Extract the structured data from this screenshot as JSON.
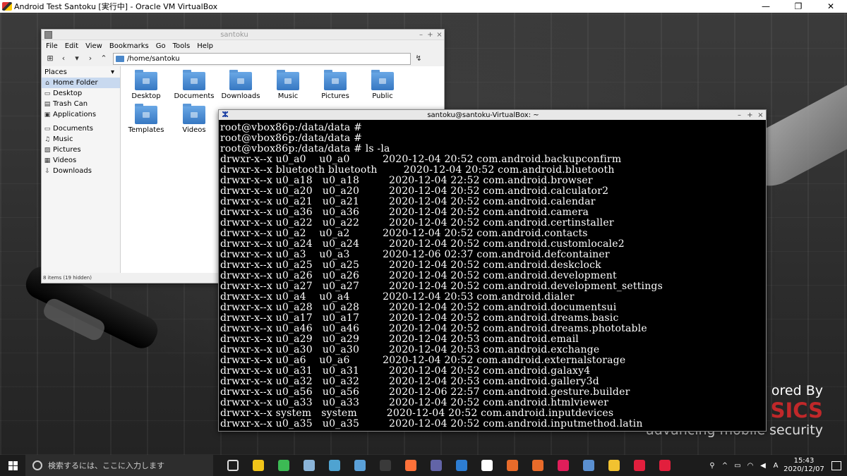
{
  "host": {
    "title": "Android Test Santoku [実行中] - Oracle VM VirtualBox",
    "minimize": "—",
    "maximize": "❐",
    "close": "✕"
  },
  "branding": {
    "powered": "ored By",
    "forensics": "SICS",
    "tagline": "advancing mobile security"
  },
  "file_manager": {
    "title": "santoku",
    "menu": [
      "File",
      "Edit",
      "View",
      "Bookmarks",
      "Go",
      "Tools",
      "Help"
    ],
    "path": "/home/santoku",
    "places_label": "Places",
    "places": [
      {
        "label": "Home Folder",
        "icon": "home-icon"
      },
      {
        "label": "Desktop",
        "icon": "desktop-icon"
      },
      {
        "label": "Trash Can",
        "icon": "trash-icon"
      },
      {
        "label": "Applications",
        "icon": "applications-icon"
      }
    ],
    "bookmarks": [
      {
        "label": "Documents",
        "icon": "folder-icon"
      },
      {
        "label": "Music",
        "icon": "music-icon"
      },
      {
        "label": "Pictures",
        "icon": "pictures-icon"
      },
      {
        "label": "Videos",
        "icon": "videos-icon"
      },
      {
        "label": "Downloads",
        "icon": "downloads-icon"
      }
    ],
    "folders": [
      "Desktop",
      "Documents",
      "Downloads",
      "Music",
      "Pictures",
      "Public",
      "Templates",
      "Videos"
    ],
    "status": "8 items (19 hidden)"
  },
  "terminal": {
    "title": "santoku@santoku-VirtualBox: ~",
    "lines": [
      "root@vbox86p:/data/data #",
      "root@vbox86p:/data/data #",
      "root@vbox86p:/data/data # ls -la",
      "drwxr-x--x u0_a0    u0_a0          2020-12-04 20:52 com.android.backupconfirm",
      "drwxr-x--x bluetooth bluetooth        2020-12-04 20:52 com.android.bluetooth",
      "drwxr-x--x u0_a18   u0_a18         2020-12-04 22:52 com.android.browser",
      "drwxr-x--x u0_a20   u0_a20         2020-12-04 20:52 com.android.calculator2",
      "drwxr-x--x u0_a21   u0_a21         2020-12-04 20:52 com.android.calendar",
      "drwxr-x--x u0_a36   u0_a36         2020-12-04 20:52 com.android.camera",
      "drwxr-x--x u0_a22   u0_a22         2020-12-04 20:52 com.android.certinstaller",
      "drwxr-x--x u0_a2    u0_a2          2020-12-04 20:52 com.android.contacts",
      "drwxr-x--x u0_a24   u0_a24         2020-12-04 20:52 com.android.customlocale2",
      "drwxr-x--x u0_a3    u0_a3          2020-12-06 02:37 com.android.defcontainer",
      "drwxr-x--x u0_a25   u0_a25         2020-12-04 20:52 com.android.deskclock",
      "drwxr-x--x u0_a26   u0_a26         2020-12-04 20:52 com.android.development",
      "drwxr-x--x u0_a27   u0_a27         2020-12-04 20:52 com.android.development_settings",
      "drwxr-x--x u0_a4    u0_a4          2020-12-04 20:53 com.android.dialer",
      "drwxr-x--x u0_a28   u0_a28         2020-12-04 20:52 com.android.documentsui",
      "drwxr-x--x u0_a17   u0_a17         2020-12-04 20:52 com.android.dreams.basic",
      "drwxr-x--x u0_a46   u0_a46         2020-12-04 20:52 com.android.dreams.phototable",
      "drwxr-x--x u0_a29   u0_a29         2020-12-04 20:53 com.android.email",
      "drwxr-x--x u0_a30   u0_a30         2020-12-04 20:53 com.android.exchange",
      "drwxr-x--x u0_a6    u0_a6          2020-12-04 20:52 com.android.externalstorage",
      "drwxr-x--x u0_a31   u0_a31         2020-12-04 20:52 com.android.galaxy4",
      "drwxr-x--x u0_a32   u0_a32         2020-12-04 20:53 com.android.gallery3d",
      "drwxr-x--x u0_a56   u0_a56         2020-12-06 22:57 com.android.gesture.builder",
      "drwxr-x--x u0_a33   u0_a33         2020-12-04 20:52 com.android.htmlviewer",
      "drwxr-x--x system   system         2020-12-04 20:52 com.android.inputdevices",
      "drwxr-x--x u0_a35   u0_a35         2020-12-04 20:52 com.android.inputmethod.latin"
    ]
  },
  "taskbar": {
    "search_placeholder": "検索するには、ここに入力します",
    "apps": [
      {
        "name": "task-view",
        "color": "#1c1c1c"
      },
      {
        "name": "file-explorer",
        "color": "#f0c419"
      },
      {
        "name": "chrome",
        "color": "#3cba54"
      },
      {
        "name": "app-3",
        "color": "#8ab4d8"
      },
      {
        "name": "app-4",
        "color": "#4fa3d1"
      },
      {
        "name": "app-5",
        "color": "#5aa0d8"
      },
      {
        "name": "terminal-app",
        "color": "#3a3a3a"
      },
      {
        "name": "firefox",
        "color": "#ff7139"
      },
      {
        "name": "teams",
        "color": "#6264a7"
      },
      {
        "name": "app-9",
        "color": "#2d7dd2"
      },
      {
        "name": "app-10",
        "color": "#ffffff"
      },
      {
        "name": "app-11",
        "color": "#e86b2a"
      },
      {
        "name": "app-12",
        "color": "#e86b2a"
      },
      {
        "name": "slack",
        "color": "#e01e5a"
      },
      {
        "name": "virtualbox",
        "color": "#5a8fd0"
      },
      {
        "name": "app-15",
        "color": "#f2c230"
      },
      {
        "name": "app-16",
        "color": "#e21f3d"
      },
      {
        "name": "app-17",
        "color": "#e21f3d"
      }
    ],
    "ime": "A",
    "time": "15:43",
    "date": "2020/12/07"
  }
}
